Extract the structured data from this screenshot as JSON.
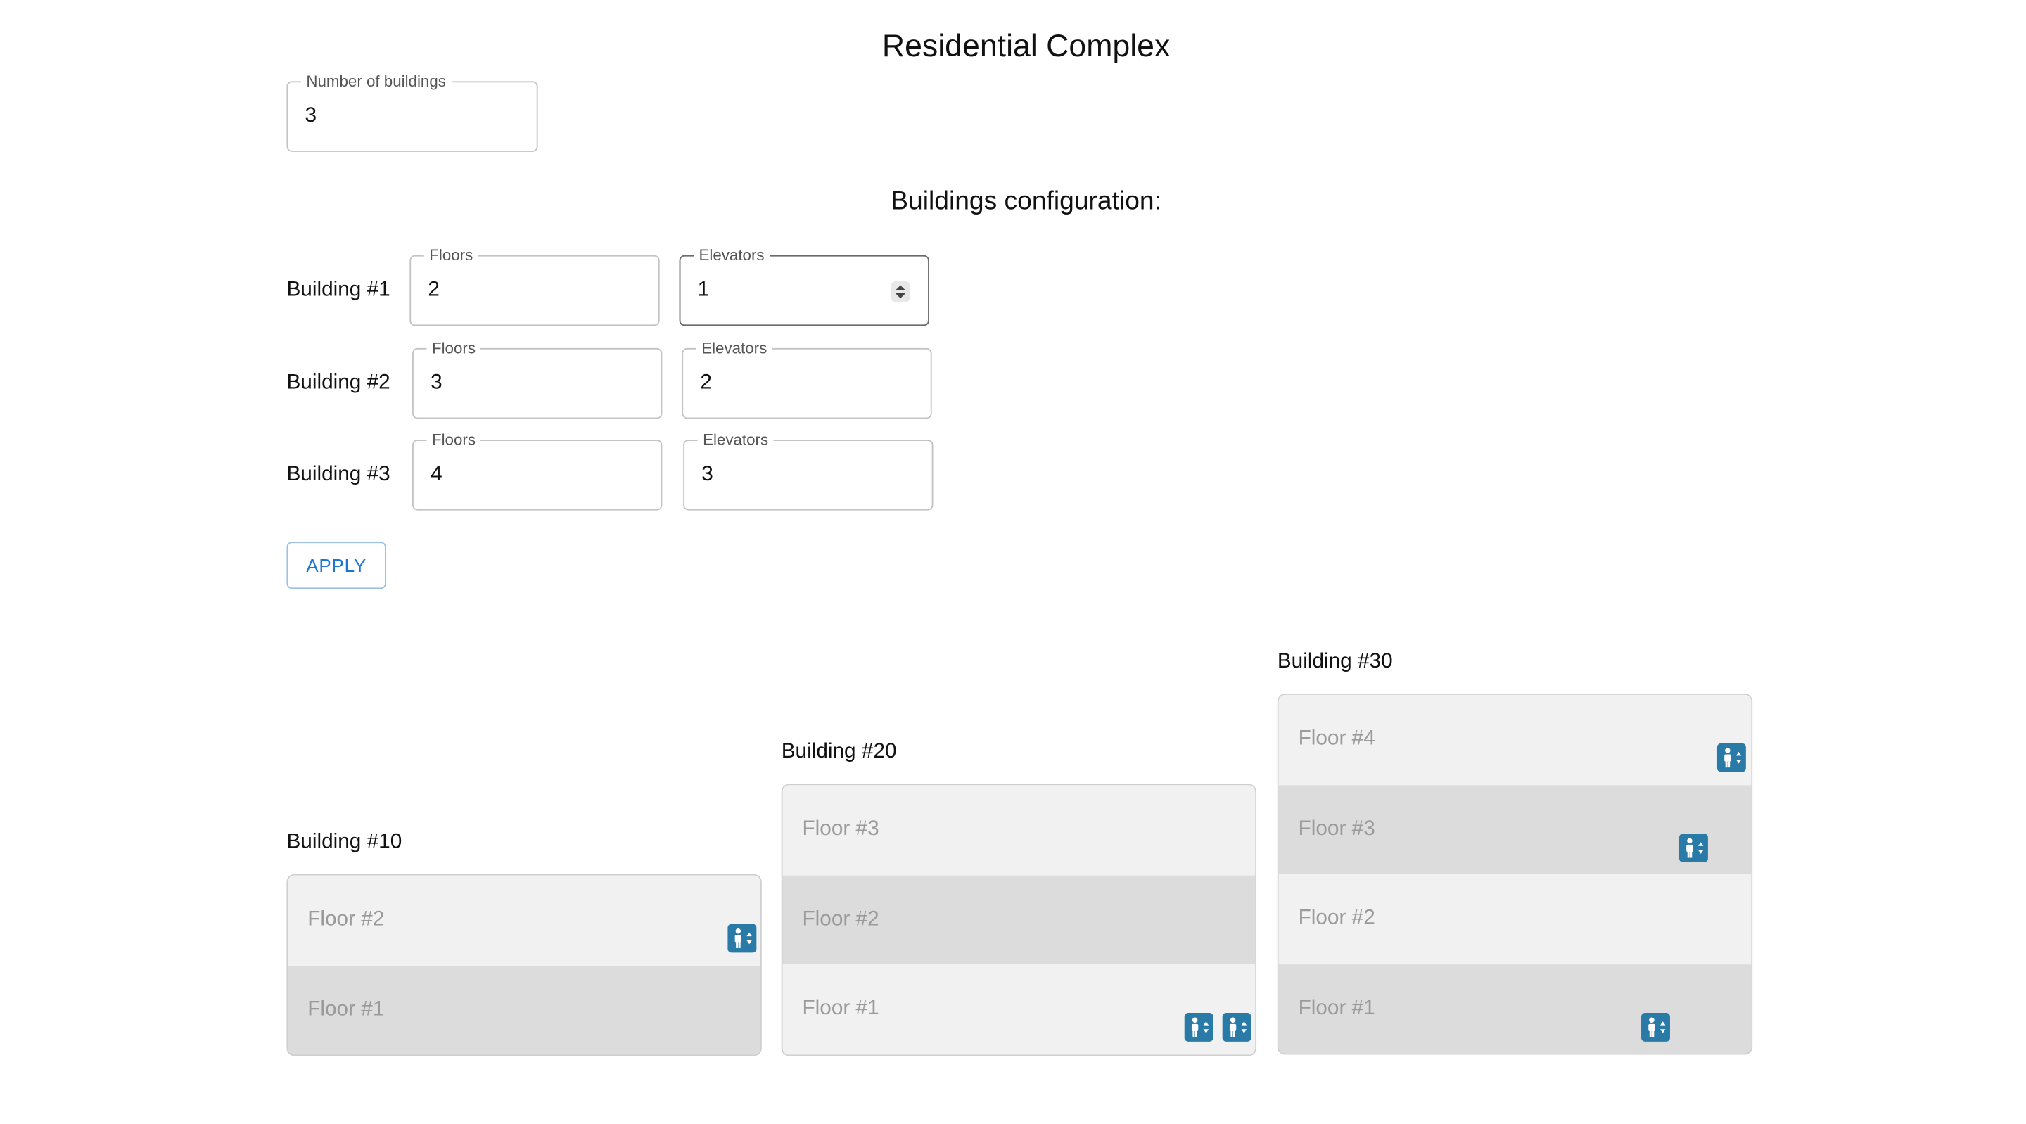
{
  "header": {
    "title": "Residential Complex",
    "config_title": "Buildings configuration:"
  },
  "count_field": {
    "label": "Number of buildings",
    "value": "3"
  },
  "config_rows": [
    {
      "label": "Building #1",
      "floors_label": "Floors",
      "floors": "2",
      "elevators_label": "Elevators",
      "elevators": "1"
    },
    {
      "label": "Building #2",
      "floors_label": "Floors",
      "floors": "3",
      "elevators_label": "Elevators",
      "elevators": "2"
    },
    {
      "label": "Building #3",
      "floors_label": "Floors",
      "floors": "4",
      "elevators_label": "Elevators",
      "elevators": "3"
    }
  ],
  "apply_label": "APPLY",
  "buildings": [
    {
      "name": "Building #10",
      "floors": [
        "Floor #2",
        "Floor #1"
      ]
    },
    {
      "name": "Building #20",
      "floors": [
        "Floor #3",
        "Floor #2",
        "Floor #1"
      ]
    },
    {
      "name": "Building #30",
      "floors": [
        "Floor #4",
        "Floor #3",
        "Floor #2",
        "Floor #1"
      ]
    }
  ],
  "colors": {
    "accent": "#1976d2",
    "elevator": "#2a7aa8",
    "floor_light": "#f1f1f1",
    "floor_dark": "#dcdcdc"
  },
  "icons": {
    "elevator": "elevator-icon"
  }
}
